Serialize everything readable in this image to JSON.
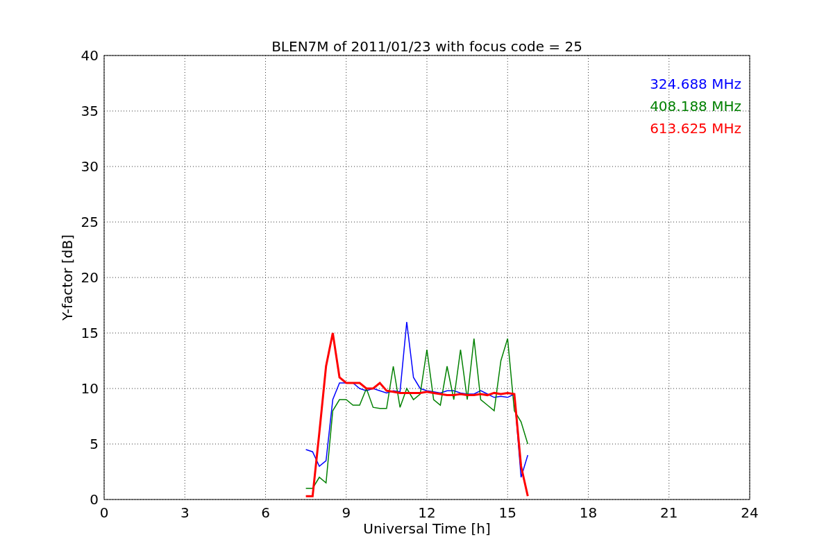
{
  "chart_data": {
    "type": "line",
    "title": "BLEN7M of 2011/01/23 with focus code = 25",
    "xlabel": "Universal Time [h]",
    "ylabel": "Y-factor [dB]",
    "x": [
      7.5,
      7.75,
      8,
      8.25,
      8.5,
      8.75,
      9,
      9.25,
      9.5,
      9.75,
      10,
      10.25,
      10.5,
      10.75,
      11,
      11.25,
      11.5,
      11.75,
      12,
      12.25,
      12.5,
      12.75,
      13,
      13.25,
      13.5,
      13.75,
      14,
      14.25,
      14.5,
      14.75,
      15,
      15.25,
      15.5,
      15.75
    ],
    "series": [
      {
        "name": "324.688 MHz",
        "color": "#0000ff",
        "values": [
          4.5,
          4.3,
          3,
          3.5,
          9,
          10.5,
          10.5,
          10.5,
          10,
          9.8,
          10,
          9.8,
          9.6,
          9.8,
          9.7,
          16,
          11,
          10,
          9.8,
          9.7,
          9.6,
          9.8,
          9.8,
          9.6,
          9.5,
          9.5,
          9.8,
          9.5,
          9.2,
          9.3,
          9.2,
          9.5,
          2,
          4
        ]
      },
      {
        "name": "408.188 MHz",
        "color": "#008000",
        "values": [
          1,
          1,
          2,
          1.5,
          8,
          9,
          9,
          8.5,
          8.5,
          10,
          8.3,
          8.2,
          8.2,
          12,
          8.3,
          10,
          9,
          9.5,
          13.5,
          9,
          8.5,
          12,
          9,
          13.5,
          9,
          14.5,
          9,
          8.5,
          8,
          12.5,
          14.5,
          8,
          7,
          5
        ]
      },
      {
        "name": "613.625 MHz",
        "color": "#ff0000",
        "values": [
          0.3,
          0.3,
          6,
          12,
          15,
          11,
          10.5,
          10.5,
          10.5,
          10,
          10,
          10.5,
          9.8,
          9.7,
          9.6,
          9.6,
          9.6,
          9.6,
          9.7,
          9.6,
          9.5,
          9.4,
          9.4,
          9.5,
          9.4,
          9.4,
          9.5,
          9.4,
          9.6,
          9.5,
          9.6,
          9.5,
          3,
          0.3
        ]
      }
    ],
    "grid": true,
    "xlim": [
      0,
      24
    ],
    "ylim": [
      0,
      40
    ],
    "xticks": [
      0,
      3,
      6,
      9,
      12,
      15,
      18,
      21,
      24
    ],
    "yticks": [
      0,
      5,
      10,
      15,
      20,
      25,
      30,
      35,
      40
    ]
  }
}
